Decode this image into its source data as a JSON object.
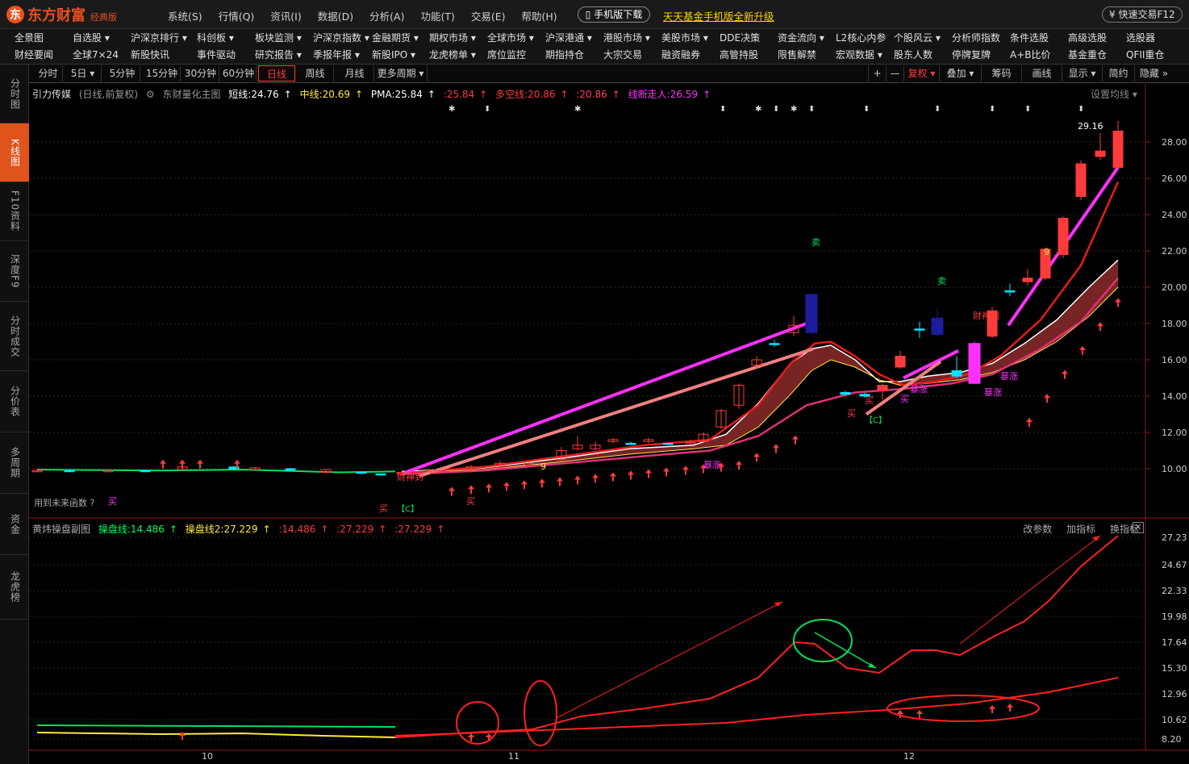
{
  "app": {
    "brand": "东方财富",
    "edition": "经典版",
    "mobile_download": "手机版下载",
    "promo": "天天基金手机版全新升级",
    "quick_trade": "快速交易F12"
  },
  "main_menu": [
    "系统(S)",
    "行情(Q)",
    "资讯(I)",
    "数据(D)",
    "分析(A)",
    "功能(T)",
    "交易(E)",
    "帮助(H)"
  ],
  "nav_row1": [
    "全景图",
    "自选股 ▾",
    "沪深京排行 ▾",
    "科创板 ▾",
    "板块监测 ▾",
    "沪深京指数 ▾",
    "金融期货 ▾",
    "期权市场 ▾",
    "全球市场 ▾",
    "沪深港通 ▾",
    "港股市场 ▾",
    "美股市场 ▾",
    "DDE决策",
    "资金流向 ▾",
    "L2核心内参",
    "个股风云 ▾",
    "分析师指数",
    "条件选股",
    "高级选股",
    "选股器"
  ],
  "nav_row2": [
    "财经要闻",
    "全球7×24",
    "新股快讯",
    "事件驱动",
    "研究报告 ▾",
    "季报年报 ▾",
    "新股IPO ▾",
    "龙虎榜单 ▾",
    "席位监控",
    "期指持仓",
    "大宗交易",
    "融资融券",
    "高管持股",
    "限售解禁",
    "宏观数据 ▾",
    "股东人数",
    "停牌复牌",
    "A+B比价",
    "基金重仓",
    "QFII重仓"
  ],
  "sidebar": [
    "分时图",
    "K线图",
    "F10资料",
    "深度F9",
    "分时成交",
    "分价表",
    "多周期",
    "资金",
    "龙虎榜"
  ],
  "periods": [
    "分时",
    "5日 ▾",
    "5分钟",
    "15分钟",
    "30分钟",
    "60分钟",
    "日线",
    "周线",
    "月线",
    "更多周期 ▾"
  ],
  "tools": [
    "+",
    "—",
    "复权 ▾",
    "叠加 ▾",
    "筹码",
    "画线",
    "显示 ▾",
    "简约",
    "隐藏 »"
  ],
  "main_legend": {
    "stock": "引力传媒",
    "mode": "(日线,前复权)",
    "template": "东财量化主图",
    "short": "短线:24.76",
    "mid": "中线:20.69",
    "pma": "PMA:25.84",
    "v4": ":25.84",
    "dk": "多空线:20.86",
    "v6": ":20.86",
    "xd": "线断走人:26.59",
    "set_ma": "设置均线 ▾"
  },
  "sub_legend": {
    "name": "黄炜操盘副图",
    "l1": "操盘线:14.486",
    "l2": "操盘线2:27.229",
    "v3": ":14.486",
    "v4": ":27.229",
    "v5": ":27.229",
    "links": [
      "改参数",
      "加指标",
      "换指标"
    ]
  },
  "future_fn": "用到未来函数 ?",
  "price_axis": [
    "28.00",
    "26.00",
    "24.00",
    "22.00",
    "20.00",
    "18.00",
    "16.00",
    "14.00",
    "12.00",
    "10.00"
  ],
  "sub_axis": [
    "27.23",
    "24.67",
    "22.33",
    "19.98",
    "17.64",
    "15.30",
    "12.96",
    "10.62",
    "8.20"
  ],
  "date_labels": [
    "10",
    "11",
    "12"
  ],
  "peak_label": "29.16",
  "annotations": {
    "buy": "买",
    "sell": "卖",
    "caishen": "财神到",
    "surge": "暴涨",
    "c": "【C】",
    "nine": "9"
  },
  "colors": {
    "up": "#ff3b3b",
    "down": "#00e5ff",
    "magenta": "#ff30ff",
    "salmon": "#f08080",
    "accent": "#e0541c"
  }
}
